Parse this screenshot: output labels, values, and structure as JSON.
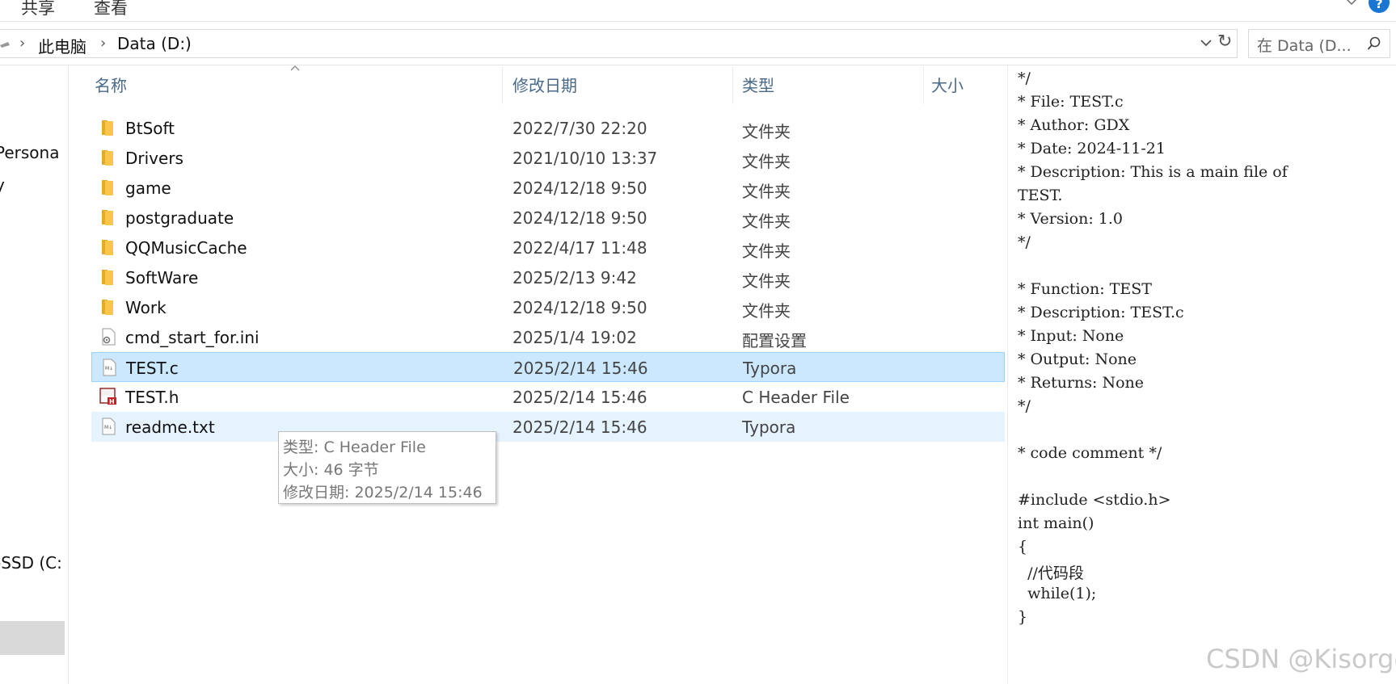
{
  "ribbon": {
    "tabs": [
      "共享",
      "查看"
    ]
  },
  "address": {
    "breadcrumb": [
      "此电脑",
      "Data (D:)"
    ]
  },
  "search": {
    "placeholder": "在 Data (D..."
  },
  "nav": {
    "items": [
      "Persona",
      "y",
      "-SSD (C:"
    ]
  },
  "columns": {
    "name": "名称",
    "date": "修改日期",
    "type": "类型",
    "size": "大小"
  },
  "files": [
    {
      "name": "BtSoft",
      "date": "2022/7/30 22:20",
      "type": "文件夹",
      "icon": "folder-icon",
      "state": "normal"
    },
    {
      "name": "Drivers",
      "date": "2021/10/10 13:37",
      "type": "文件夹",
      "icon": "folder-icon",
      "state": "normal"
    },
    {
      "name": "game",
      "date": "2024/12/18 9:50",
      "type": "文件夹",
      "icon": "folder-icon",
      "state": "normal"
    },
    {
      "name": "postgraduate",
      "date": "2024/12/18 9:50",
      "type": "文件夹",
      "icon": "folder-icon",
      "state": "normal"
    },
    {
      "name": "QQMusicCache",
      "date": "2022/4/17 11:48",
      "type": "文件夹",
      "icon": "folder-icon",
      "state": "normal"
    },
    {
      "name": "SoftWare",
      "date": "2025/2/13 9:42",
      "type": "文件夹",
      "icon": "folder-icon",
      "state": "normal"
    },
    {
      "name": "Work",
      "date": "2024/12/18 9:50",
      "type": "文件夹",
      "icon": "folder-icon",
      "state": "normal"
    },
    {
      "name": "cmd_start_for.ini",
      "date": "2025/1/4 19:02",
      "type": "配置设置",
      "icon": "config-file-icon",
      "state": "normal"
    },
    {
      "name": "TEST.c",
      "date": "2025/2/14 15:46",
      "type": "Typora",
      "icon": "markdown-file-icon",
      "state": "selected"
    },
    {
      "name": "TEST.h",
      "date": "2025/2/14 15:46",
      "type": "C Header File",
      "icon": "c-header-file-icon",
      "state": "normal"
    },
    {
      "name": "readme.txt",
      "date": "2025/2/14 15:46",
      "type": "Typora",
      "icon": "markdown-file-icon",
      "state": "hover"
    }
  ],
  "tooltip": {
    "type": "类型: C Header File",
    "size": "大小: 46 字节",
    "modified": "修改日期: 2025/2/14 15:46"
  },
  "preview": {
    "lines": [
      "*/",
      "* File: TEST.c",
      "* Author: GDX",
      "* Date: 2024-11-21",
      "* Description: This is a main file of",
      "TEST.",
      "* Version: 1.0",
      "*/",
      "",
      "* Function: TEST",
      "* Description: TEST.c",
      "* Input: None",
      "* Output: None",
      "* Returns: None",
      "*/",
      "",
      "* code comment */",
      "",
      "#include <stdio.h>",
      "int main()",
      "{",
      "  //代码段",
      "  while(1);",
      "}"
    ]
  },
  "watermark": "CSDN @Kisorge",
  "colors": {
    "selected_bg": "#cce8ff",
    "hover_bg": "#e5f3ff",
    "folder": "#f8c64a",
    "help": "#1976d2"
  }
}
